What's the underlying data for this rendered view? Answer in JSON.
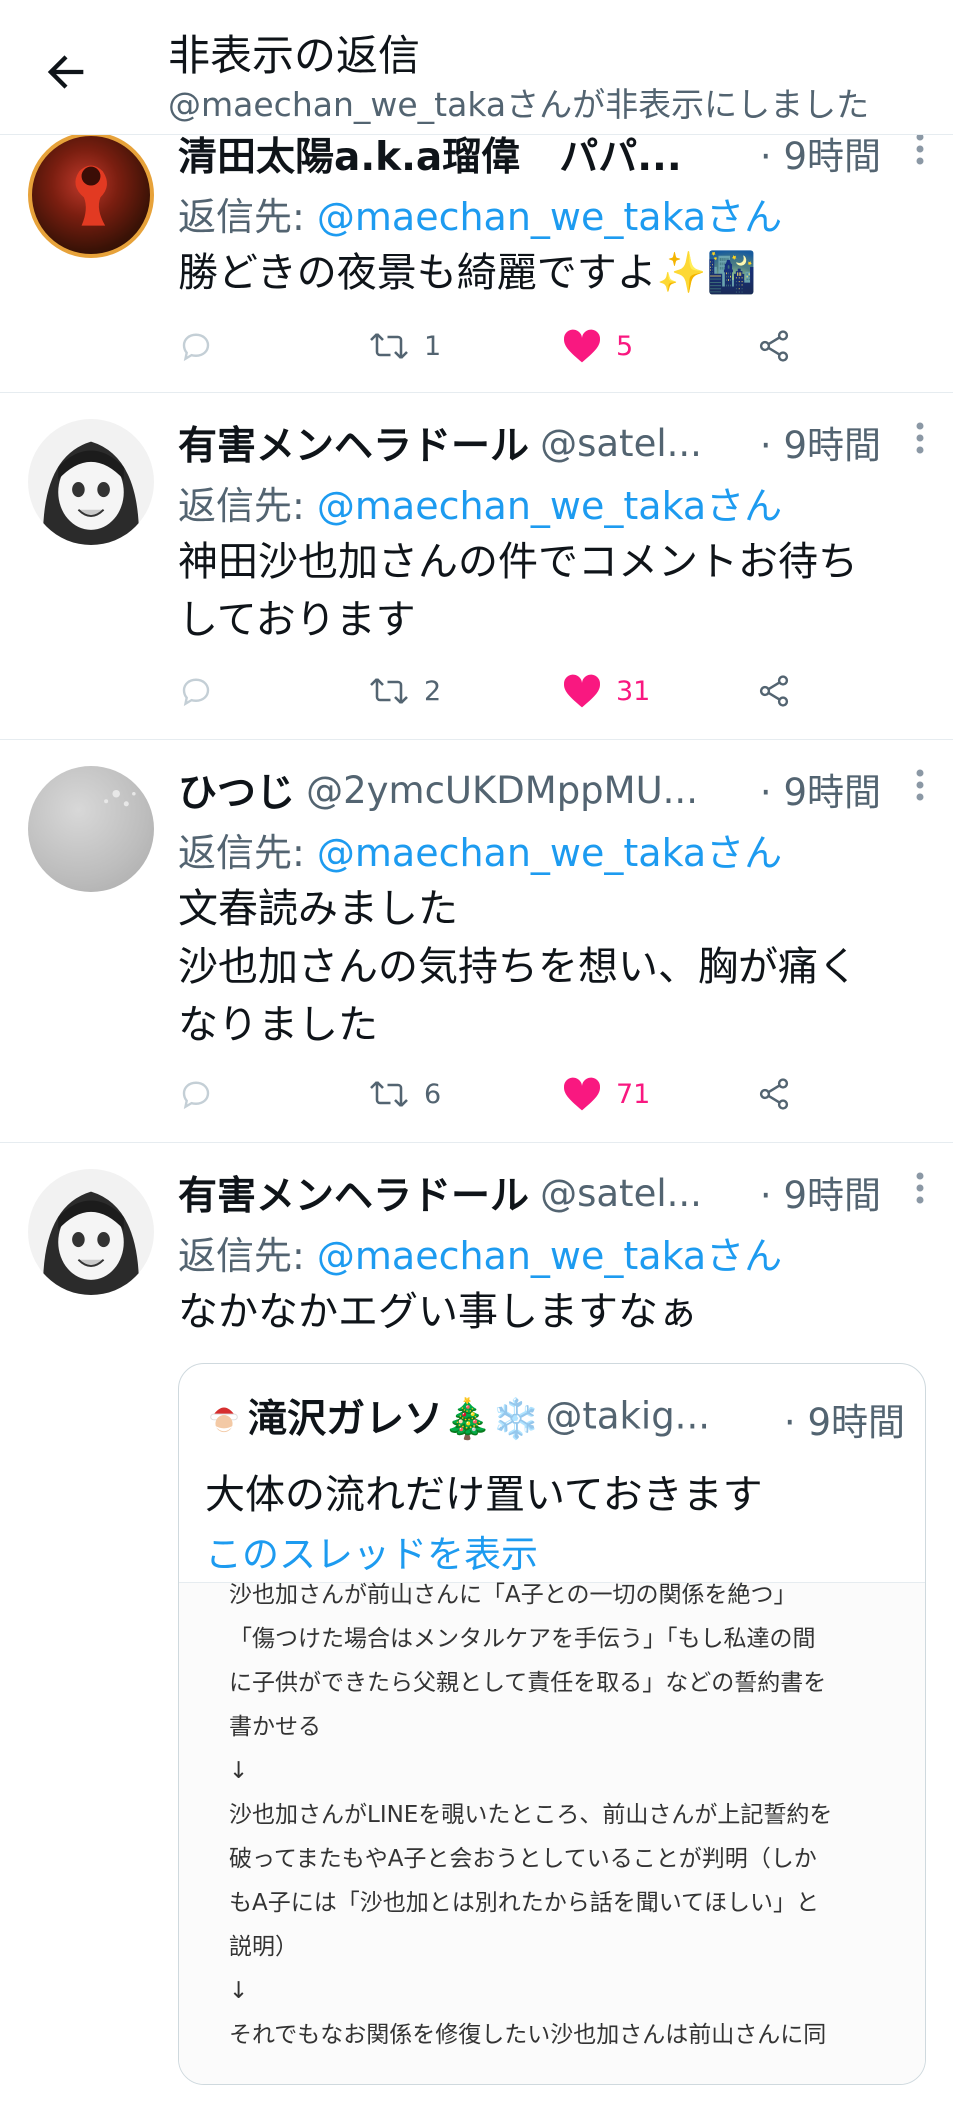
{
  "header": {
    "title": "非表示の返信",
    "subtitle": "@maechan_we_takaさんが非表示にしました"
  },
  "tweets": [
    {
      "name": "清田太陽a.k.a瑠偉　パパ...",
      "handle": "",
      "time": "· 9時間",
      "reply_prefix": "返信先: ",
      "reply_to": "@maechan_we_takaさん",
      "lines": [
        "勝どきの夜景も綺麗ですよ✨🌃"
      ],
      "retweets": "1",
      "likes": "5",
      "liked": true
    },
    {
      "name": "有害メンヘラドール",
      "handle": "@satel...",
      "time": "· 9時間",
      "reply_prefix": "返信先: ",
      "reply_to": "@maechan_we_takaさん",
      "lines": [
        "神田沙也加さんの件でコメントお待ち",
        "しております"
      ],
      "retweets": "2",
      "likes": "31",
      "liked": true
    },
    {
      "name": "ひつじ",
      "handle": "@2ymcUKDMppMU...",
      "time": "· 9時間",
      "reply_prefix": "返信先: ",
      "reply_to": "@maechan_we_takaさん",
      "lines": [
        "文春読みました",
        "沙也加さんの気持ちを想い、胸が痛く",
        "なりました"
      ],
      "retweets": "6",
      "likes": "71",
      "liked": true
    },
    {
      "name": "有害メンヘラドール",
      "handle": "@satel...",
      "time": "· 9時間",
      "reply_prefix": "返信先: ",
      "reply_to": "@maechan_we_takaさん",
      "lines": [
        "なかなかエグい事しますなぁ"
      ],
      "quote": {
        "name": "滝沢ガレソ🎄❄️",
        "handle": "@takig...",
        "time": "· 9時間",
        "text": "大体の流れだけ置いておきます",
        "thread_link": "このスレッドを表示",
        "image_lines": [
          "沙也加さんが前山さんに「A子との一切の関係を絶つ」",
          "「傷つけた場合はメンタルケアを手伝う」「もし私達の間",
          "に子供ができたら父親として責任を取る」などの誓約書を",
          "書かせる",
          "↓",
          "沙也加さんがLINEを覗いたところ、前山さんが上記誓約を",
          "破ってまたもやA子と会おうとしていることが判明（しか",
          "もA子には「沙也加とは別れたから話を聞いてほしい」と",
          "説明）",
          "↓",
          "それでもなお関係を修復したい沙也加さんは前山さんに同"
        ]
      }
    }
  ],
  "colors": {
    "accent": "#1d9bf0",
    "like": "#f91880",
    "muted": "#536471",
    "text": "#0f1419"
  }
}
